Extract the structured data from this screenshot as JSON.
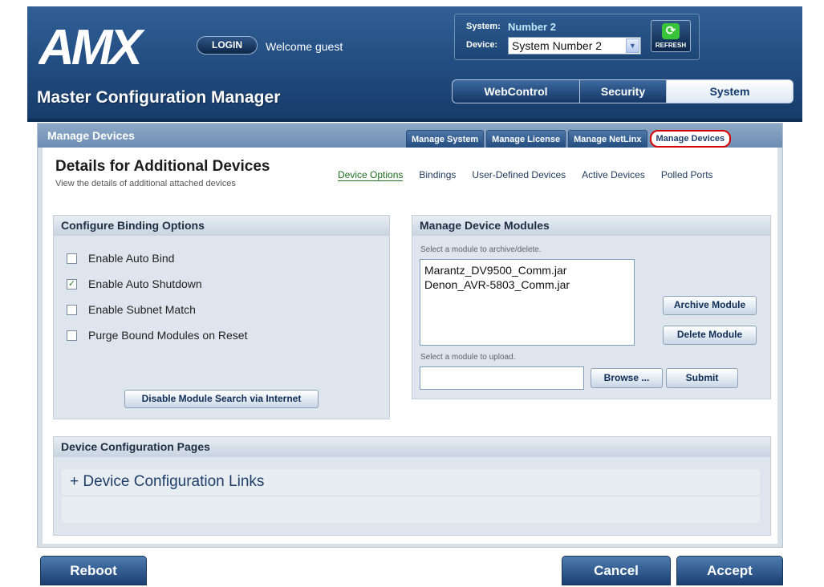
{
  "header": {
    "logo_text": "AMX",
    "login_label": "LOGIN",
    "welcome_text": "Welcome guest",
    "app_title": "Master Configuration Manager",
    "system_label": "System:",
    "system_value": "Number 2",
    "device_label": "Device:",
    "device_selected": "System Number 2",
    "refresh_label": "REFRESH",
    "tabs": [
      {
        "label": "WebControl",
        "active": false
      },
      {
        "label": "Security",
        "active": false
      },
      {
        "label": "System",
        "active": true
      }
    ]
  },
  "panel": {
    "title": "Manage Devices",
    "sub_tabs": [
      {
        "label": "Manage System",
        "active": false
      },
      {
        "label": "Manage License",
        "active": false
      },
      {
        "label": "Manage NetLinx",
        "active": false
      },
      {
        "label": "Manage Devices",
        "active": true
      }
    ],
    "details_title": "Details for Additional Devices",
    "details_subtitle": "View the details of additional attached devices",
    "detail_links": [
      {
        "label": "Device Options",
        "active": true
      },
      {
        "label": "Bindings",
        "active": false
      },
      {
        "label": "User-Defined Devices",
        "active": false
      },
      {
        "label": "Active Devices",
        "active": false
      },
      {
        "label": "Polled Ports",
        "active": false
      }
    ]
  },
  "binding": {
    "title": "Configure Binding Options",
    "options": [
      {
        "label": "Enable Auto Bind",
        "checked": false
      },
      {
        "label": "Enable Auto Shutdown",
        "checked": true
      },
      {
        "label": "Enable Subnet Match",
        "checked": false
      },
      {
        "label": "Purge Bound Modules on Reset",
        "checked": false
      }
    ],
    "disable_search_label": "Disable Module Search via Internet"
  },
  "modules": {
    "title": "Manage Device Modules",
    "select_label": "Select a module to archive/delete.",
    "items": [
      "Marantz_DV9500_Comm.jar",
      "Denon_AVR-5803_Comm.jar"
    ],
    "archive_label": "Archive Module",
    "delete_label": "Delete Module",
    "upload_label": "Select a module to upload.",
    "upload_value": "",
    "browse_label": "Browse ...",
    "submit_label": "Submit"
  },
  "config_pages": {
    "title": "Device Configuration Pages",
    "links_label": "+ Device Configuration Links"
  },
  "footer": {
    "reboot_label": "Reboot",
    "cancel_label": "Cancel",
    "accept_label": "Accept"
  },
  "colors": {
    "header_blue": "#214c80",
    "active_link_green": "#1d6e1d",
    "highlight_red": "#d60000",
    "checkmark_green": "#2a7a2a"
  }
}
